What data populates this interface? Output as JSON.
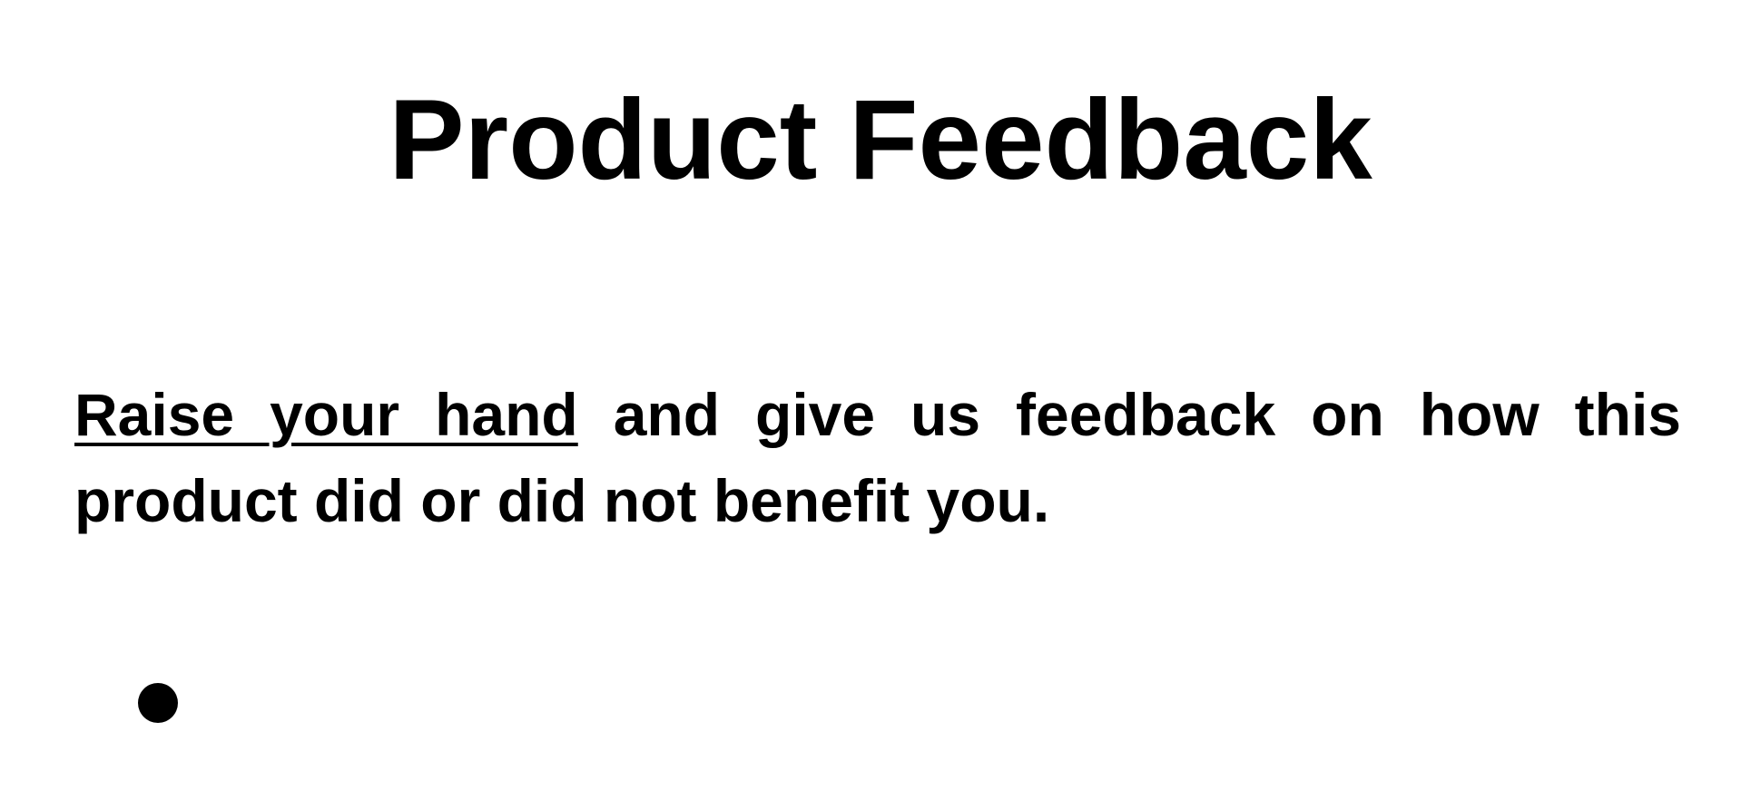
{
  "page": {
    "title": "Product Feedback",
    "body": {
      "emphasis": "Raise your hand",
      "rest": " and give us feedback on how this product did or did not benefit you."
    }
  },
  "icons": {
    "bullet": "bullet-point-icon"
  },
  "colors": {
    "text": "#000000",
    "background": "#ffffff"
  }
}
